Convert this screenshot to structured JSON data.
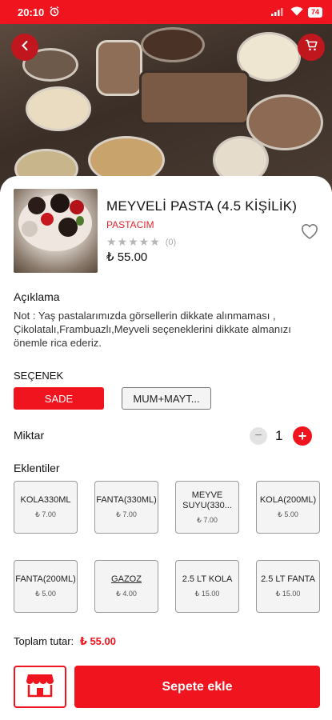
{
  "status_bar": {
    "time": "20:10",
    "battery": "74"
  },
  "product": {
    "title": "MEYVELİ PASTA (4.5 KİŞİLİK)",
    "shop": "PASTACIM",
    "stars": "★★★★★",
    "rating_count": "(0)",
    "price": "₺ 55.00"
  },
  "description": {
    "heading": "Açıklama",
    "text": "Not : Yaş pastalarımızda görsellerin dikkate alınmaması , Çikolatalı,Frambuazlı,Meyveli seçeneklerini dikkate almanızı önemle rica ederiz."
  },
  "options": {
    "heading": "SEÇENEK",
    "selected": "SADE",
    "other": "MUM+MAYT..."
  },
  "quantity": {
    "label": "Miktar",
    "value": "1",
    "minus": "−",
    "plus": "+"
  },
  "extras": {
    "heading": "Eklentiler",
    "items": [
      {
        "name": "KOLA330ML",
        "price": "₺ 7.00"
      },
      {
        "name": "FANTA(330ML)",
        "price": "₺ 7.00"
      },
      {
        "name": "MEYVE SUYU(330...",
        "price": "₺ 7.00"
      },
      {
        "name": "KOLA(200ML)",
        "price": "₺ 5.00"
      },
      {
        "name": "FANTA(200ML)",
        "price": "₺ 5.00"
      },
      {
        "name": "GAZOZ",
        "price": "₺ 4.00"
      },
      {
        "name": "2.5 LT KOLA",
        "price": "₺ 15.00"
      },
      {
        "name": "2.5 LT FANTA",
        "price": "₺ 15.00"
      }
    ]
  },
  "total": {
    "label": "Toplam tutar:",
    "amount": "₺ 55.00"
  },
  "footer": {
    "add_to_cart": "Sepete ekle"
  },
  "icons": {
    "back": "back-arrow-icon",
    "cart": "cart-icon",
    "heart": "heart-icon",
    "store": "store-icon"
  },
  "colors": {
    "accent": "#f0141e",
    "price_red": "#e0262e"
  }
}
